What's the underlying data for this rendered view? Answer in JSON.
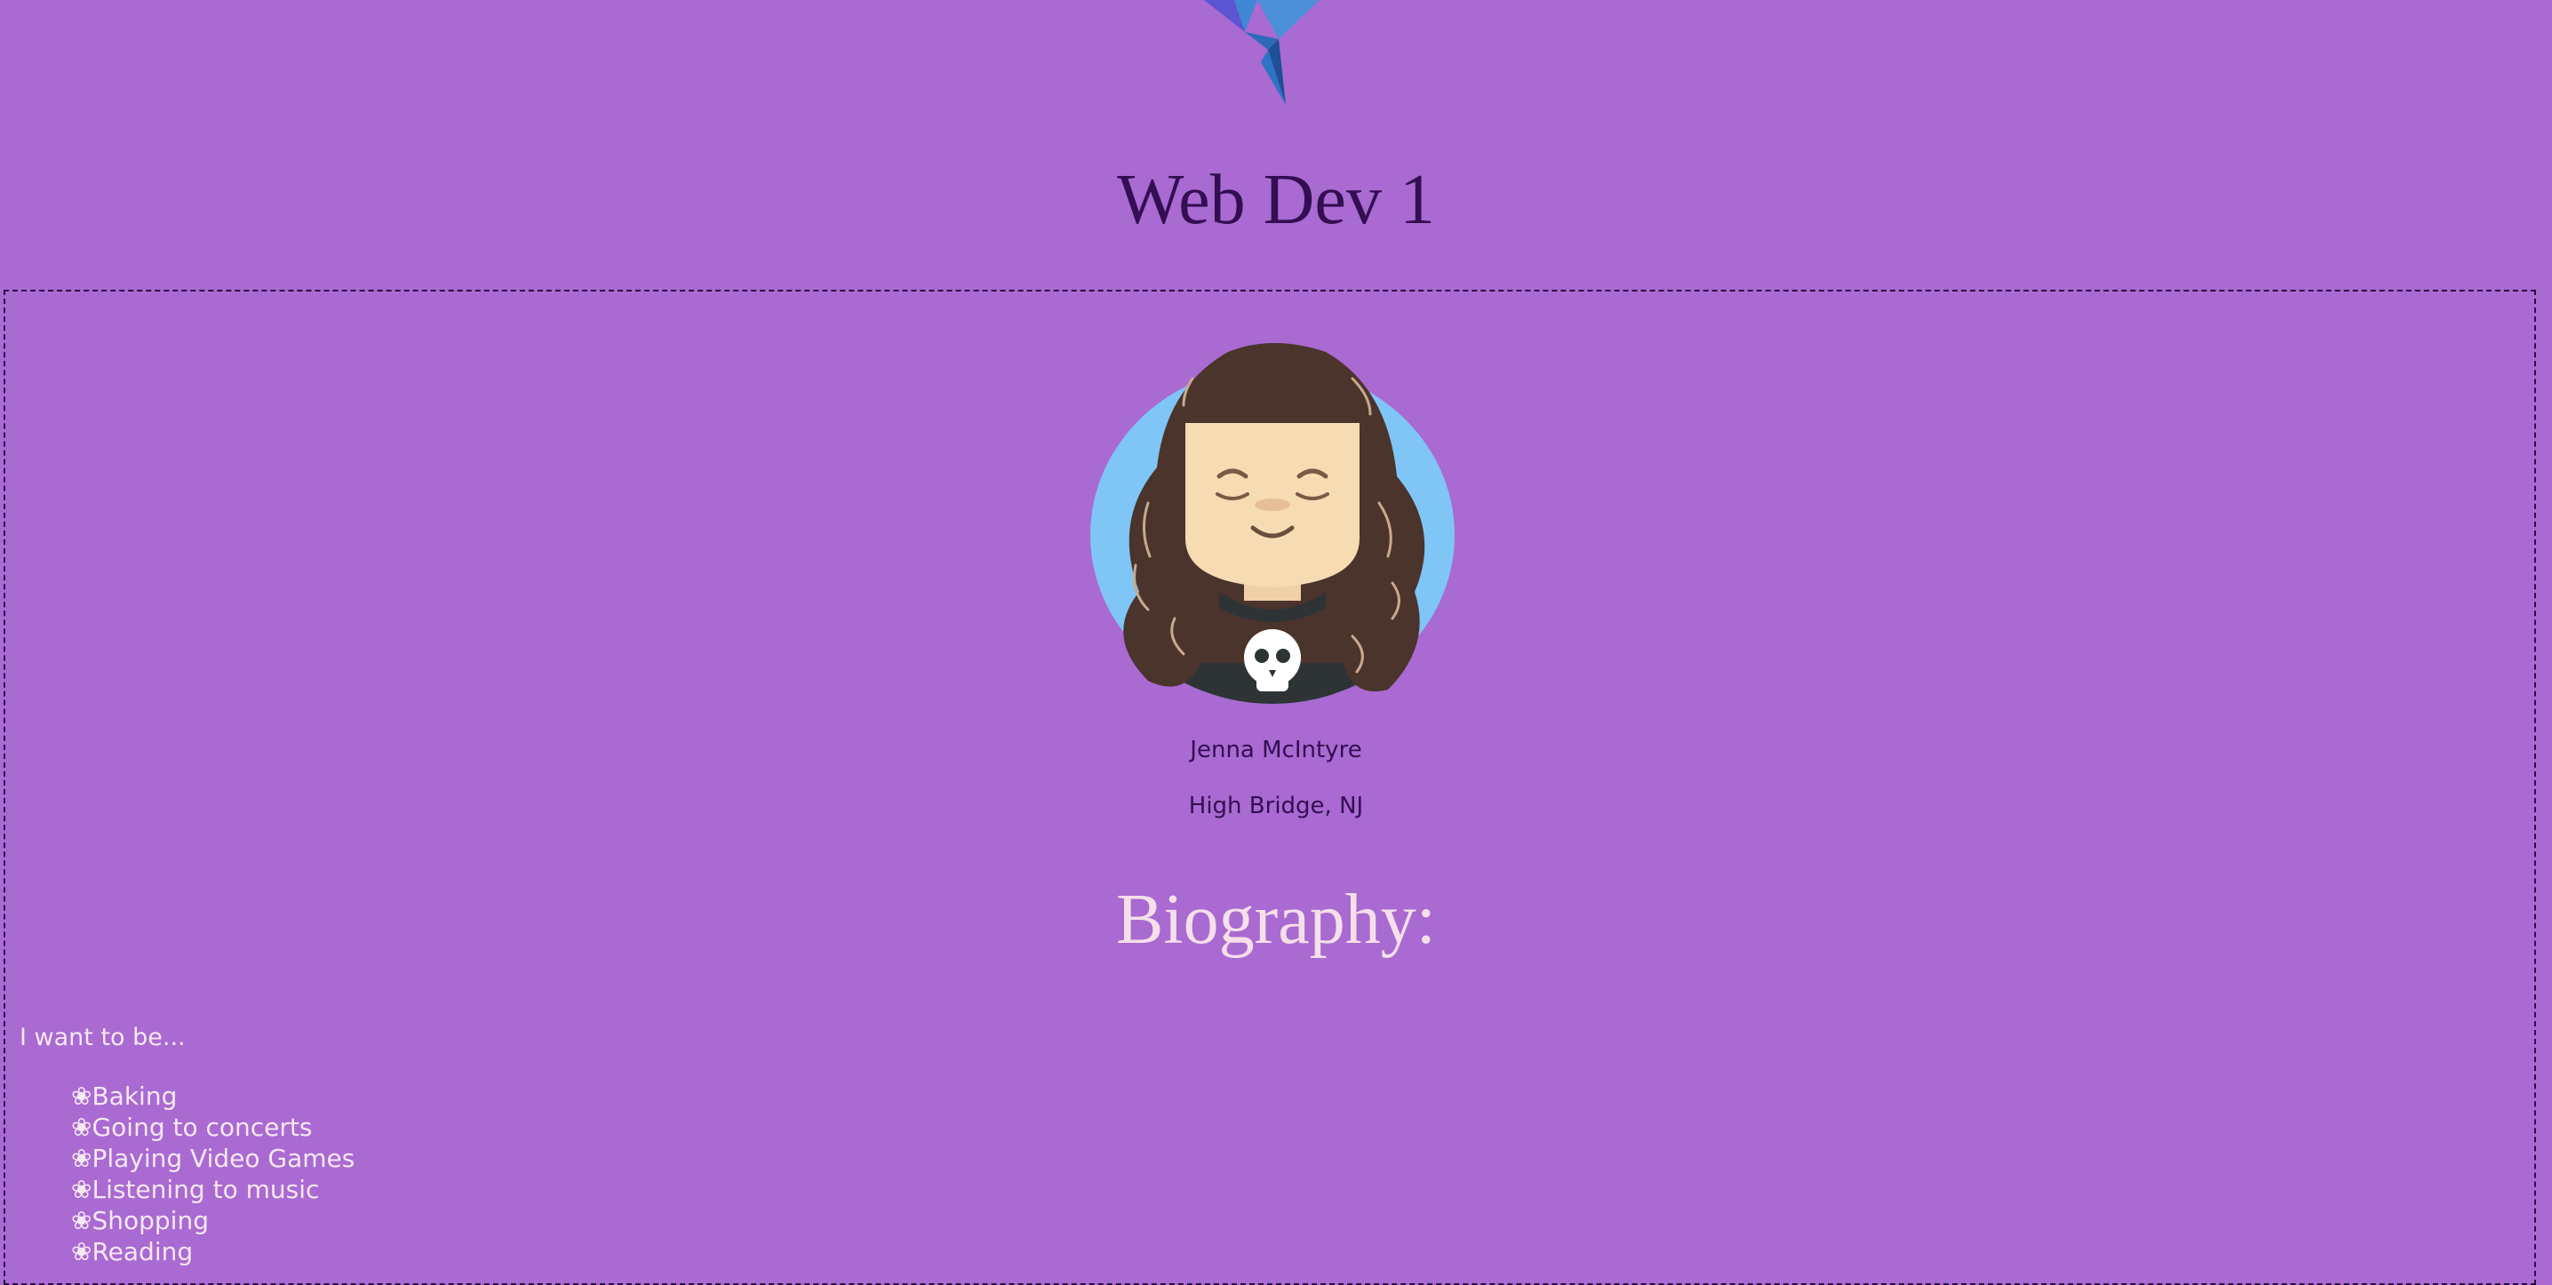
{
  "header": {
    "logo_icon": "origami-bird-icon",
    "title": "Web Dev 1"
  },
  "profile": {
    "avatar_icon": "avatar-illustration",
    "name": "Jenna McIntyre",
    "location": "High Bridge, NJ"
  },
  "biography": {
    "heading": "Biography:",
    "intro": "I want to be...",
    "bullet": "❀",
    "items": [
      {
        "label": "Baking"
      },
      {
        "label": "Going to concerts"
      },
      {
        "label": "Playing Video Games"
      },
      {
        "label": "Listening to music"
      },
      {
        "label": "Shopping"
      },
      {
        "label": "Reading"
      }
    ]
  },
  "colors": {
    "background": "#a96ad2",
    "title_text": "#330e52",
    "light_text": "#f6e8f1",
    "avatar_bg": "#7fc6f6",
    "hair": "#4a342c"
  }
}
